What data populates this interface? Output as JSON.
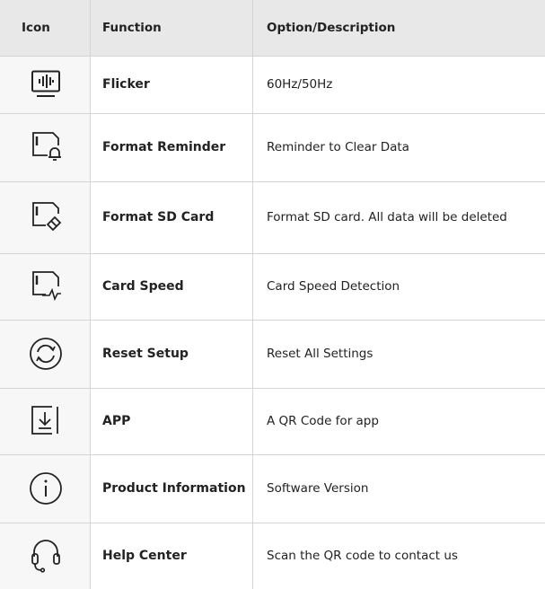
{
  "header": {
    "icon": "Icon",
    "function": "Function",
    "description": "Option/Description"
  },
  "rows": [
    {
      "icon": "flicker-icon",
      "function": "Flicker",
      "description": "60Hz/50Hz"
    },
    {
      "icon": "format-reminder-icon",
      "function": "Format Reminder",
      "description": "Reminder to Clear Data"
    },
    {
      "icon": "format-sd-card-icon",
      "function": "Format SD Card",
      "description": "Format SD card. All data will be deleted"
    },
    {
      "icon": "card-speed-icon",
      "function": "Card Speed",
      "description": "Card Speed Detection"
    },
    {
      "icon": "reset-icon",
      "function": "Reset Setup",
      "description": "Reset All Settings"
    },
    {
      "icon": "app-download-icon",
      "function": "APP",
      "description": "A QR Code for app"
    },
    {
      "icon": "info-icon",
      "function": "Product Information",
      "description": "Software Version"
    },
    {
      "icon": "headset-icon",
      "function": "Help Center",
      "description": "Scan the QR code to contact us"
    }
  ]
}
